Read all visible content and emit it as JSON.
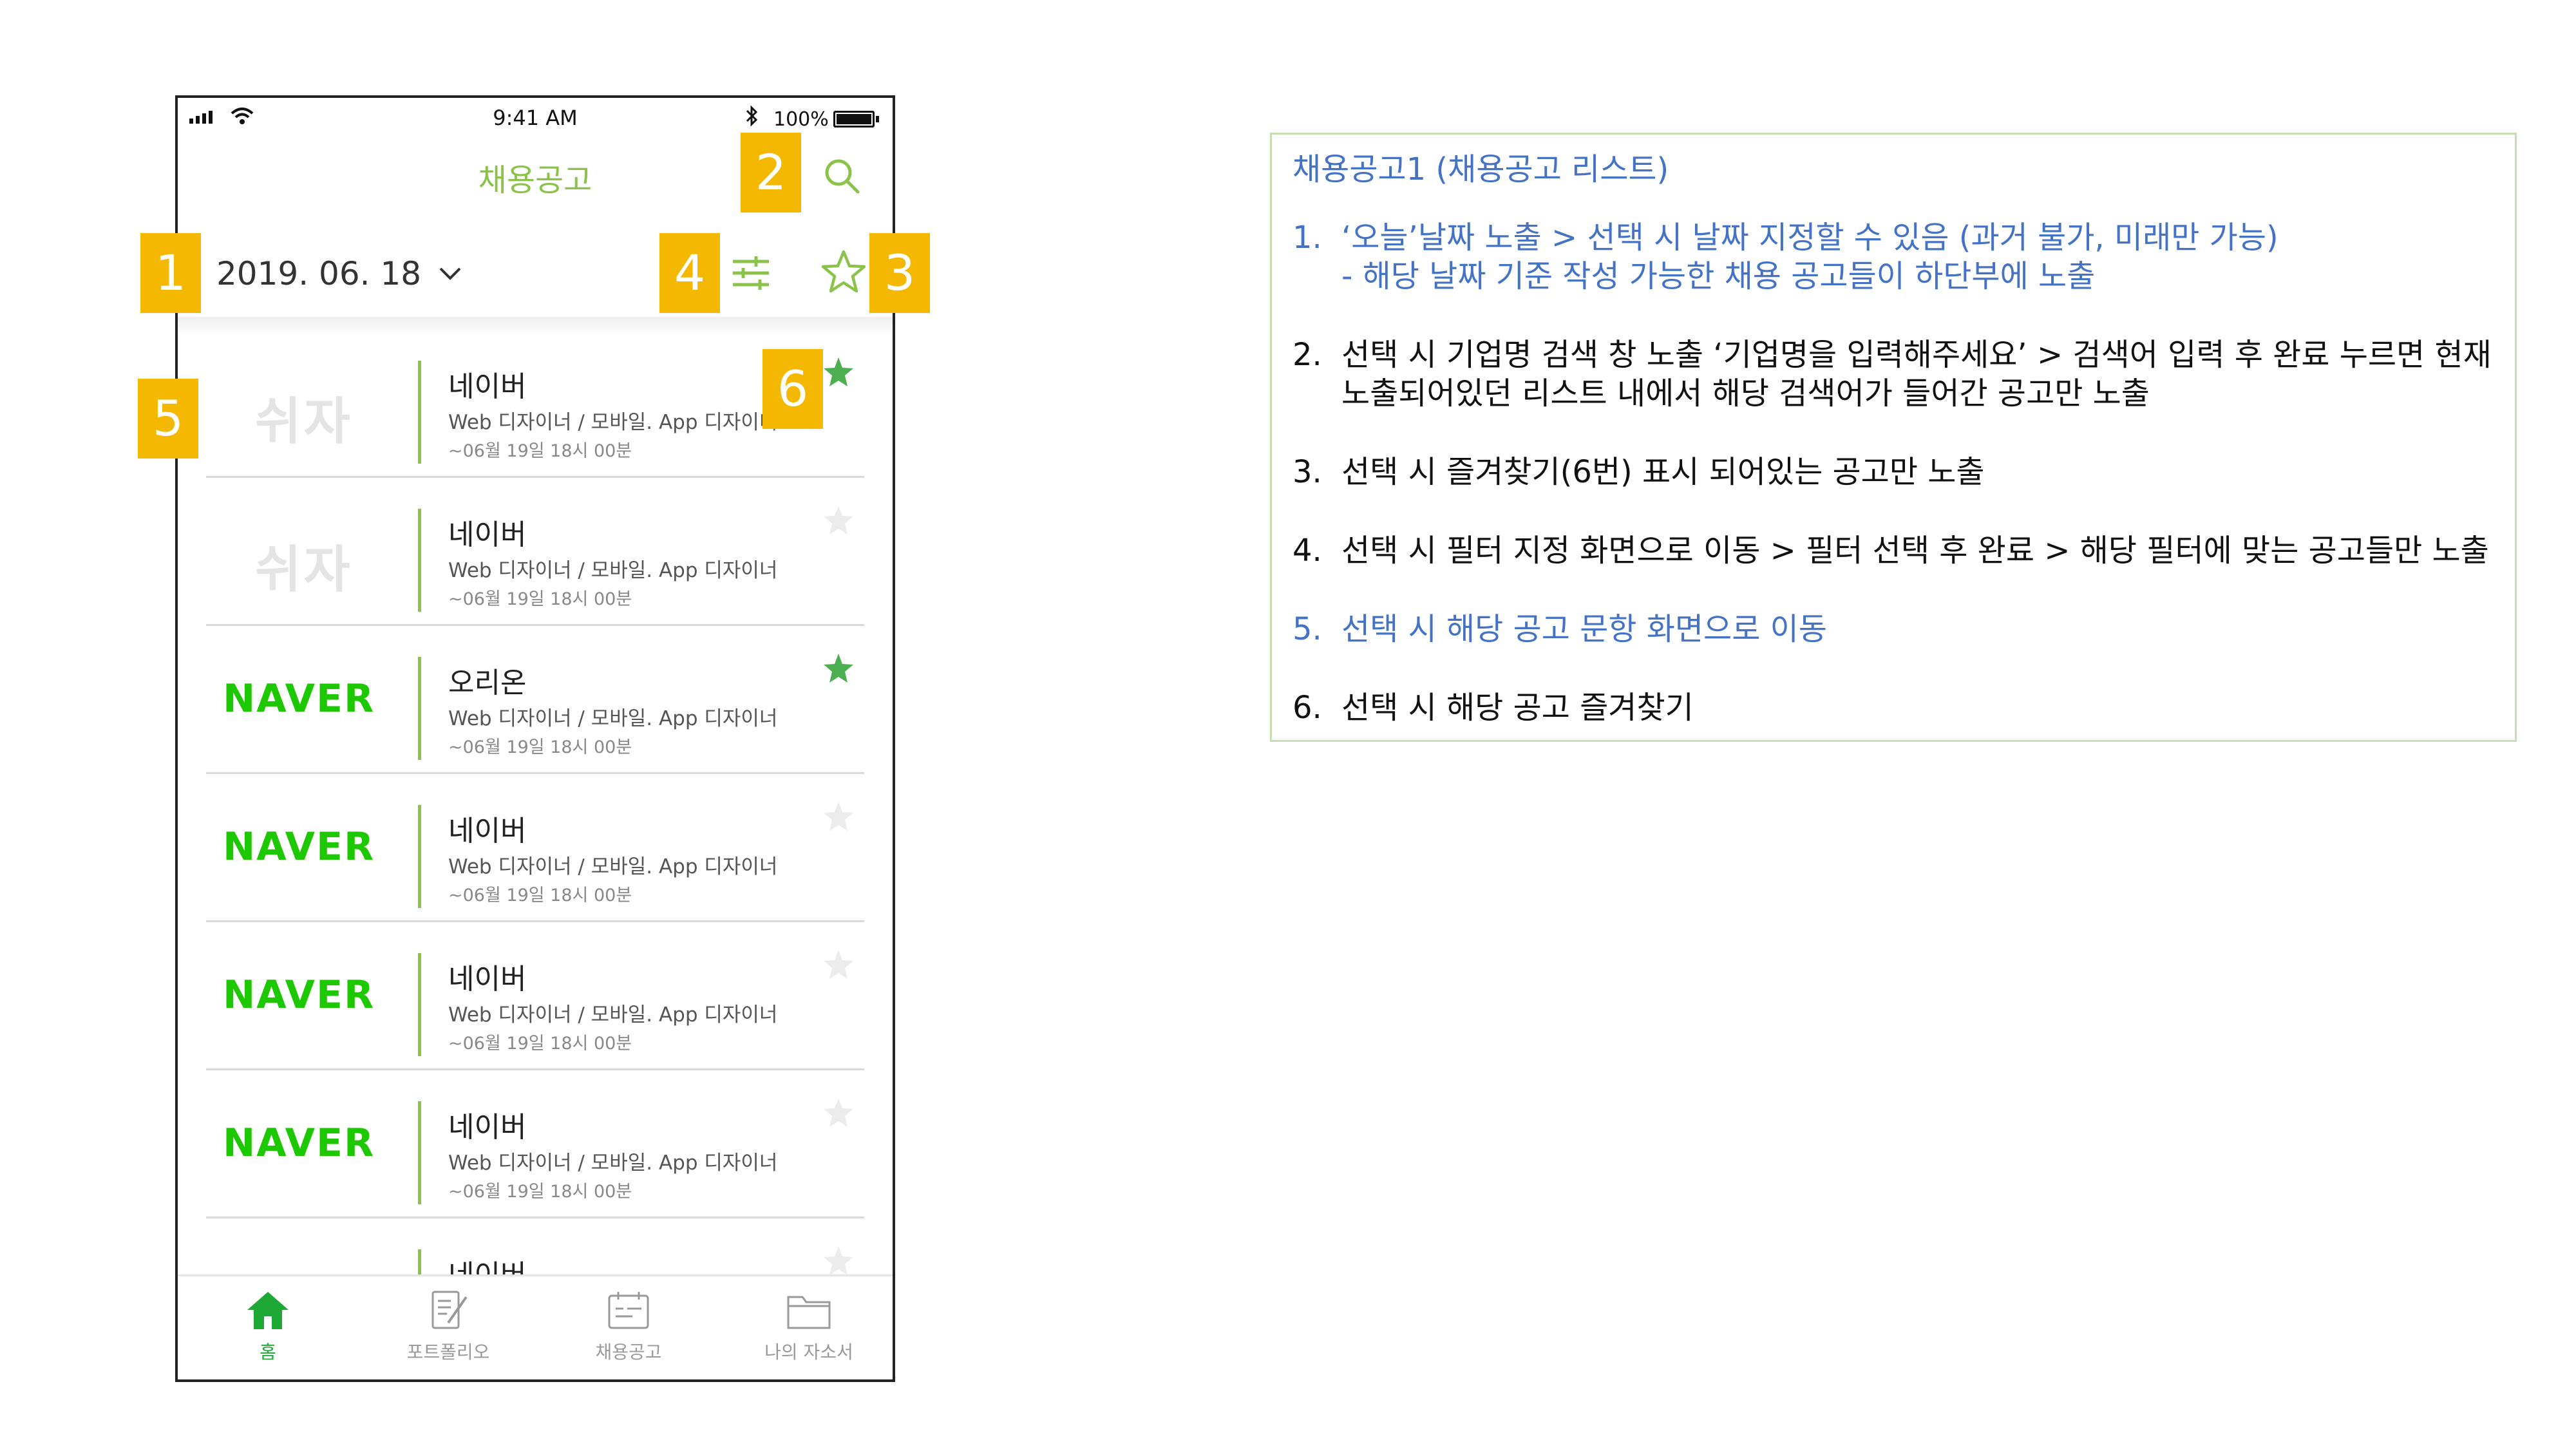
{
  "status_bar": {
    "time": "9:41 AM",
    "battery": "100%"
  },
  "app": {
    "title": "채용공고",
    "date": "2019. 06. 18"
  },
  "list": [
    {
      "logo": "쉬자",
      "company": "네이버",
      "position": "Web 디자이너 / 모바일. App 디자이너",
      "deadline": "~06월 19일 18시 00분",
      "favorite": true
    },
    {
      "logo": "쉬자",
      "company": "네이버",
      "position": "Web 디자이너 / 모바일. App 디자이너",
      "deadline": "~06월 19일 18시 00분",
      "favorite": false
    },
    {
      "logo": "NAVER",
      "company": "오리온",
      "position": "Web 디자이너 / 모바일. App 디자이너",
      "deadline": "~06월 19일 18시 00분",
      "favorite": true
    },
    {
      "logo": "NAVER",
      "company": "네이버",
      "position": "Web 디자이너 / 모바일. App 디자이너",
      "deadline": "~06월 19일 18시 00분",
      "favorite": false
    },
    {
      "logo": "NAVER",
      "company": "네이버",
      "position": "Web 디자이너 / 모바일. App 디자이너",
      "deadline": "~06월 19일 18시 00분",
      "favorite": false
    },
    {
      "logo": "NAVER",
      "company": "네이버",
      "position": "Web 디자이너 / 모바일. App 디자이너",
      "deadline": "~06월 19일 18시 00분",
      "favorite": false
    },
    {
      "logo": "",
      "company": "네이버",
      "position": "",
      "deadline": "",
      "favorite": false
    }
  ],
  "tabs": [
    {
      "label": "홈",
      "icon": "home-icon",
      "active": true
    },
    {
      "label": "포트폴리오",
      "icon": "portfolio-icon",
      "active": false
    },
    {
      "label": "채용공고",
      "icon": "calendar-icon",
      "active": false
    },
    {
      "label": "나의 자소서",
      "icon": "folder-icon",
      "active": false
    }
  ],
  "callouts": [
    "1",
    "2",
    "3",
    "4",
    "5",
    "6"
  ],
  "description": {
    "title": "채용공고1 (채용공고 리스트)",
    "items": [
      {
        "num": "1.",
        "lines": [
          "‘오늘’날짜 노출 > 선택 시 날짜 지정할 수 있음 (과거 불가, 미래만 가능)",
          "- 해당 날짜 기준 작성 가능한 채용 공고들이 하단부에 노출"
        ],
        "highlight": true
      },
      {
        "num": "2.",
        "lines": [
          "선택 시 기업명 검색 창 노출 ‘기업명을 입력해주세요’ > 검색어 입력 후 완료 누르면 현재",
          "노출되어있던 리스트 내에서 해당 검색어가 들어간 공고만 노출"
        ],
        "highlight": false
      },
      {
        "num": "3.",
        "lines": [
          "선택 시 즐겨찾기(6번) 표시 되어있는 공고만 노출"
        ],
        "highlight": false
      },
      {
        "num": "4.",
        "lines": [
          "선택 시 필터 지정 화면으로 이동 > 필터 선택 후 완료 > 해당 필터에 맞는 공고들만 노출"
        ],
        "highlight": false
      },
      {
        "num": "5.",
        "lines": [
          "선택 시 해당 공고 문항 화면으로 이동"
        ],
        "highlight": true
      },
      {
        "num": "6.",
        "lines": [
          "선택 시 해당 공고 즐겨찾기"
        ],
        "highlight": false
      }
    ]
  },
  "colors": {
    "accent": "#8bc34a",
    "callout": "#f5b800",
    "naver": "#1ec800",
    "link": "#4472c4"
  }
}
